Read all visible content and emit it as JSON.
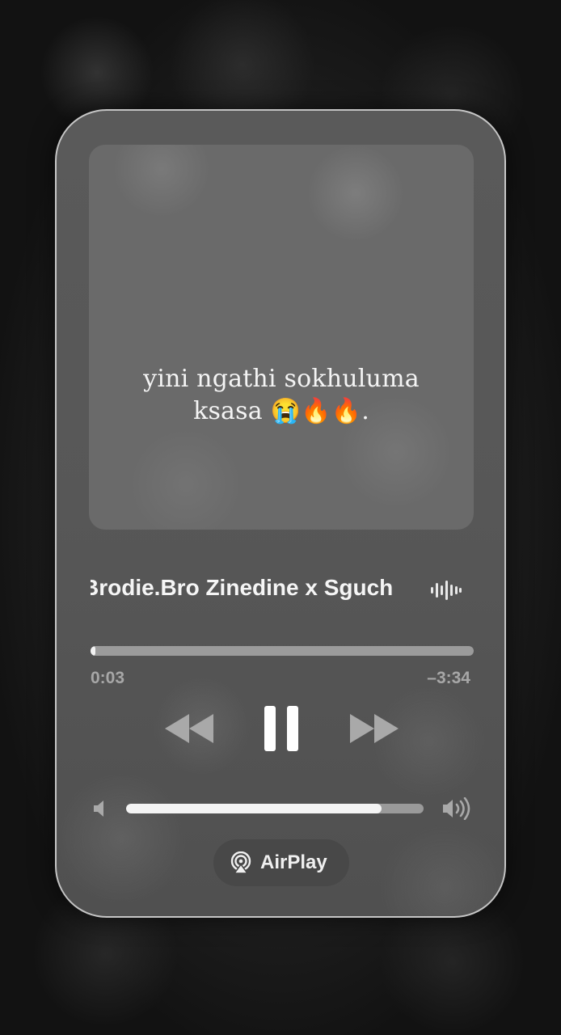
{
  "artwork": {
    "caption": "yini ngathi sokhuluma ksasa 😭🔥🔥."
  },
  "track": {
    "title": "Brodie.Bro Zinedine x Sguch"
  },
  "playback": {
    "elapsed": "0:03",
    "remaining": "–3:34",
    "progress_fraction": 0.013,
    "state": "playing"
  },
  "volume": {
    "level_fraction": 0.86
  },
  "airplay": {
    "label": "AirPlay"
  },
  "icons": {
    "waveform": "waveform-icon",
    "rewind": "rewind-icon",
    "pause": "pause-icon",
    "fast_forward": "fast-forward-icon",
    "volume_low": "speaker-low-icon",
    "volume_high": "speaker-high-icon",
    "airplay": "airplay-icon"
  },
  "colors": {
    "panel": "#575757",
    "accent": "#f2f2f2",
    "track_bg": "#9b9b9b",
    "secondary_text": "#a7a7a7"
  }
}
